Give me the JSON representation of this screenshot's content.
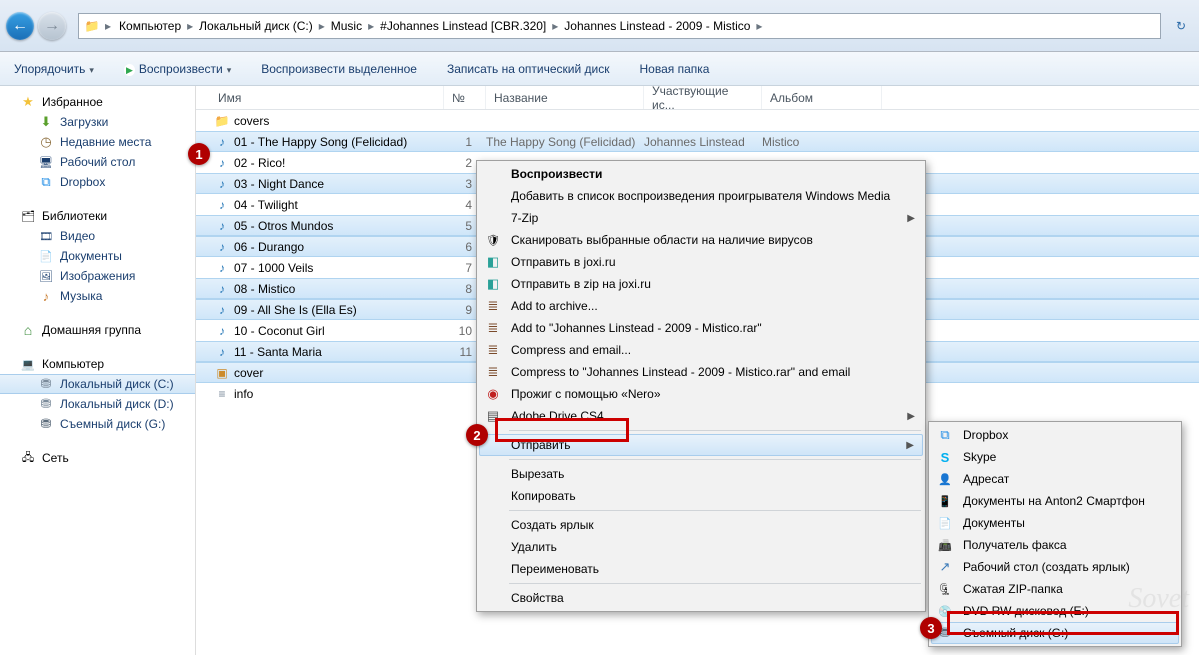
{
  "breadcrumbs": [
    "Компьютер",
    "Локальный диск (C:)",
    "Music",
    "#Johannes Linstead [CBR.320]",
    "Johannes Linstead - 2009 - Mistico"
  ],
  "toolbar": {
    "organize": "Упорядочить",
    "play": "Воспроизвести",
    "play_sel": "Воспроизвести выделенное",
    "burn": "Записать на оптический диск",
    "new_folder": "Новая папка"
  },
  "columns": {
    "name": "Имя",
    "num": "№",
    "title": "Название",
    "artist": "Участвующие ис...",
    "album": "Альбом"
  },
  "sidebar": {
    "favorites": {
      "label": "Избранное",
      "items": [
        {
          "icon": "i-dl",
          "label": "Загрузки"
        },
        {
          "icon": "i-clock",
          "label": "Недавние места"
        },
        {
          "icon": "i-desk",
          "label": "Рабочий стол"
        },
        {
          "icon": "i-dropbox",
          "label": "Dropbox"
        }
      ]
    },
    "libraries": {
      "label": "Библиотеки",
      "items": [
        {
          "icon": "i-vid",
          "label": "Видео"
        },
        {
          "icon": "i-doc",
          "label": "Документы"
        },
        {
          "icon": "i-img",
          "label": "Изображения"
        },
        {
          "icon": "i-mus",
          "label": "Музыка"
        }
      ]
    },
    "homegroup": {
      "label": "Домашняя группа"
    },
    "computer": {
      "label": "Компьютер",
      "items": [
        {
          "icon": "i-drive",
          "label": "Локальный диск (C:)",
          "sel": true
        },
        {
          "icon": "i-drive",
          "label": "Локальный диск (D:)"
        },
        {
          "icon": "i-usb",
          "label": "Съемный диск (G:)"
        }
      ]
    },
    "network": {
      "label": "Сеть"
    }
  },
  "files": [
    {
      "icon": "folder",
      "name": "covers"
    },
    {
      "icon": "music",
      "name": "01 - The Happy Song (Felicidad)",
      "num": "1",
      "title": "The Happy Song (Felicidad)",
      "artist": "Johannes Linstead",
      "album": "Mistico",
      "sel": true
    },
    {
      "icon": "music",
      "name": "02 - Rico!",
      "num": "2"
    },
    {
      "icon": "music",
      "name": "03 - Night Dance",
      "num": "3",
      "sel": true
    },
    {
      "icon": "music",
      "name": "04 - Twilight",
      "num": "4"
    },
    {
      "icon": "music",
      "name": "05 - Otros Mundos",
      "num": "5",
      "sel": true
    },
    {
      "icon": "music",
      "name": "06 - Durango",
      "num": "6",
      "sel": true
    },
    {
      "icon": "music",
      "name": "07 - 1000 Veils",
      "num": "7"
    },
    {
      "icon": "music",
      "name": "08 - Mistico",
      "num": "8",
      "sel": true
    },
    {
      "icon": "music",
      "name": "09 - All She Is (Ella Es)",
      "num": "9",
      "sel": true
    },
    {
      "icon": "music",
      "name": "10 - Coconut Girl",
      "num": "10"
    },
    {
      "icon": "music",
      "name": "11 - Santa Maria",
      "num": "11",
      "sel": true
    },
    {
      "icon": "img",
      "name": "cover",
      "sel": true
    },
    {
      "icon": "txt",
      "name": "info"
    }
  ],
  "ctx_main": [
    {
      "label": "Воспроизвести",
      "bold": true
    },
    {
      "label": "Добавить в список воспроизведения проигрывателя Windows Media"
    },
    {
      "label": "7-Zip",
      "sub": true
    },
    {
      "icon": "i-shield",
      "label": "Сканировать выбранные области на наличие вирусов"
    },
    {
      "icon": "i-joxi",
      "label": "Отправить в joxi.ru"
    },
    {
      "icon": "i-joxi",
      "label": "Отправить в zip на joxi.ru"
    },
    {
      "icon": "i-rar",
      "label": "Add to archive..."
    },
    {
      "icon": "i-rar",
      "label": "Add to \"Johannes Linstead - 2009 - Mistico.rar\""
    },
    {
      "icon": "i-rar",
      "label": "Compress and email..."
    },
    {
      "icon": "i-rar",
      "label": "Compress to \"Johannes Linstead - 2009 - Mistico.rar\" and email"
    },
    {
      "icon": "i-nero",
      "label": "Прожиг с помощью «Nero»"
    },
    {
      "icon": "i-adobe",
      "label": "Adobe Drive CS4",
      "sub": true
    },
    {
      "sep": true
    },
    {
      "label": "Отправить",
      "sub": true,
      "hover": true
    },
    {
      "sep": true
    },
    {
      "label": "Вырезать"
    },
    {
      "label": "Копировать"
    },
    {
      "sep": true
    },
    {
      "label": "Создать ярлык"
    },
    {
      "label": "Удалить"
    },
    {
      "label": "Переименовать"
    },
    {
      "sep": true
    },
    {
      "label": "Свойства"
    }
  ],
  "ctx_sub": [
    {
      "icon": "i-dropbox",
      "label": "Dropbox"
    },
    {
      "icon": "i-skype",
      "label": "Skype"
    },
    {
      "icon": "i-user",
      "label": "Адресат"
    },
    {
      "icon": "i-phone",
      "label": "Документы на Anton2 Смартфон"
    },
    {
      "icon": "i-doc",
      "label": "Документы"
    },
    {
      "icon": "i-fax",
      "label": "Получатель факса"
    },
    {
      "icon": "i-link",
      "label": "Рабочий стол (создать ярлык)"
    },
    {
      "icon": "i-zip",
      "label": "Сжатая ZIP-папка"
    },
    {
      "icon": "i-dvd",
      "label": "DVD RW дисковод (E:)"
    },
    {
      "icon": "i-usb",
      "label": "Съемный диск (G:)",
      "hover": true
    }
  ],
  "callouts": {
    "c1": "1",
    "c2": "2",
    "c3": "3"
  },
  "watermark": "Sovet"
}
